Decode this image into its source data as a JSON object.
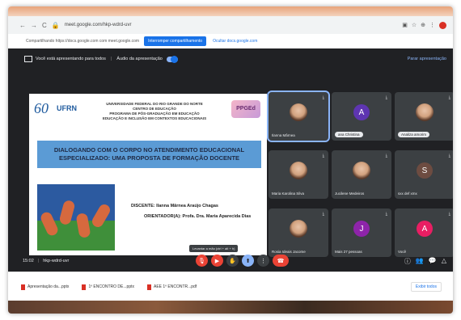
{
  "browser": {
    "url": "meet.google.com/hkp-wdrd-uvr",
    "share_notice": "Compartilhando https://docs.google.com com meet.google.com",
    "share_button": "Interromper compartilhamento",
    "share_link": "Ocultar docs.google.com"
  },
  "presenting_bar": {
    "label": "Você está apresentando para todos",
    "audio_label": "Áudio da apresentação",
    "stop_label": "Parar apresentação"
  },
  "slide": {
    "logo_number": "60",
    "logo_text": "UFRN",
    "institution_lines": [
      "UNIVERSIDADE FEDERAL DO RIO GRANDE DO NORTE",
      "CENTRO DE EDUCAÇÃO",
      "PROGRAMA DE PÓS-GRADUAÇÃO EM EDUCAÇÃO",
      "EDUCAÇÃO E INCLUSÃO EM CONTEXTOS EDUCACIONAIS"
    ],
    "program_logo": "PPGEd",
    "title": "DIALOGANDO COM O CORPO NO ATENDIMENTO EDUCACIONAL ESPECIALIZADO: UMA PROPOSTA DE FORMAÇÃO DOCENTE",
    "student": "DISCENTE: Ilanna Mârnea Araújo Chagas",
    "advisor": "ORIENTADOR(A): Profa. Dra. Maria Aparecida Dias"
  },
  "participants": [
    {
      "name": "Ilanna Mârnea",
      "type": "face",
      "color": "#c99a7a",
      "pinned": true
    },
    {
      "name": "ana Christina",
      "type": "letter",
      "letter": "A",
      "color": "#5e35b1"
    },
    {
      "name": "Analiza amorim",
      "type": "face",
      "color": "#c99a7a"
    },
    {
      "name": "Maria Karolina Silva",
      "type": "face",
      "color": "#c99a7a"
    },
    {
      "name": "Jucilene Medeiros",
      "type": "face",
      "color": "#c99a7a"
    },
    {
      "name": "sxx def xmx",
      "type": "letter",
      "letter": "S",
      "color": "#6d4c41"
    },
    {
      "name": "Rosia Ideais Jacome",
      "type": "face",
      "color": "#c99a7a"
    },
    {
      "name": "Mais 27 pessoas",
      "type": "group",
      "letter": "J",
      "color": "#8e24aa"
    },
    {
      "name": "Você",
      "type": "letter",
      "letter": "A",
      "color": "#e91e63"
    }
  ],
  "controls": {
    "time": "15:02",
    "meeting_code": "hkp-wdrd-uvr",
    "tooltip": "Levantar a mão (ctrl + alt + h)"
  },
  "downloads": {
    "items": [
      "Apresentação da...pptx",
      "1º ENCONTRO DE...pptx",
      "AEE 1º ENCONTR...pdf"
    ],
    "show_all": "Exibir todos"
  },
  "colors": {
    "meet_bg": "#202124",
    "slide_title_bg": "#5b9bd5",
    "end_call": "#ea4335",
    "accent": "#1a73e8"
  }
}
